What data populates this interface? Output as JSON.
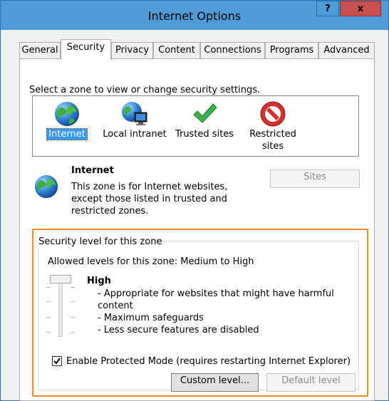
{
  "window": {
    "title": "Internet Options",
    "help_label": "?",
    "close_label": "x"
  },
  "tabs": [
    {
      "label": "General"
    },
    {
      "label": "Security",
      "active": true
    },
    {
      "label": "Privacy"
    },
    {
      "label": "Content"
    },
    {
      "label": "Connections"
    },
    {
      "label": "Programs"
    },
    {
      "label": "Advanced"
    }
  ],
  "security": {
    "prompt": "Select a zone to view or change security settings.",
    "zones": [
      {
        "label": "Internet",
        "icon": "globe-icon",
        "selected": true
      },
      {
        "label": "Local intranet",
        "icon": "intranet-globe-monitor-icon"
      },
      {
        "label": "Trusted sites",
        "icon": "green-check-icon"
      },
      {
        "label": "Restricted sites",
        "label_line1": "Restricted",
        "label_line2": "sites",
        "icon": "restricted-no-entry-icon"
      }
    ],
    "zone_info": {
      "title": "Internet",
      "desc_line1": "This zone is for Internet websites,",
      "desc_line2": "except those listed in trusted and",
      "desc_line3": "restricted zones.",
      "icon": "globe-icon"
    },
    "sites_button": "Sites",
    "level_group": {
      "label": "Security level for this zone",
      "allowed": "Allowed levels for this zone: Medium to High",
      "level_title": "High",
      "bullets": [
        "- Appropriate for websites that might have harmful",
        "content",
        "- Maximum safeguards",
        "- Less secure features are disabled"
      ],
      "slider_level": "High",
      "protected_mode_label": "Enable Protected Mode (requires restarting Internet Explorer)",
      "protected_mode_checked": true,
      "custom_level_button": "Custom level...",
      "default_level_button": "Default level"
    }
  },
  "colors": {
    "titlebar": "#4e9bd9",
    "close_button": "#c74f50",
    "highlight_border": "#f08b2a",
    "selection": "#3399ff"
  }
}
